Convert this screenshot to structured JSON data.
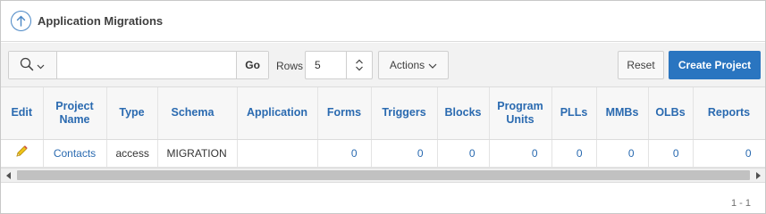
{
  "region": {
    "title": "Application Migrations",
    "collapse_icon": "arrow-up-circle-icon"
  },
  "toolbar": {
    "search_icon": "search-icon",
    "search_placeholder": "",
    "go_label": "Go",
    "rows_label": "Rows",
    "rows_value": "5",
    "actions_label": "Actions",
    "reset_label": "Reset",
    "create_label": "Create Project"
  },
  "colors": {
    "accent": "#2a75c0",
    "link": "#2a6ab0",
    "edit_icon": "#e0b020"
  },
  "table": {
    "columns": [
      "Edit",
      "Project Name",
      "Type",
      "Schema",
      "Application",
      "Forms",
      "Triggers",
      "Blocks",
      "Program Units",
      "PLLs",
      "MMBs",
      "OLBs",
      "Reports"
    ],
    "rows": [
      {
        "edit_icon": "pencil-icon",
        "project_name": "Contacts",
        "type": "access",
        "schema": "MIGRATION",
        "application": "",
        "forms": "0",
        "triggers": "0",
        "blocks": "0",
        "program_units": "0",
        "plls": "0",
        "mmbs": "0",
        "olbs": "0",
        "reports": "0"
      }
    ]
  },
  "pagination": {
    "text": "1 - 1"
  }
}
